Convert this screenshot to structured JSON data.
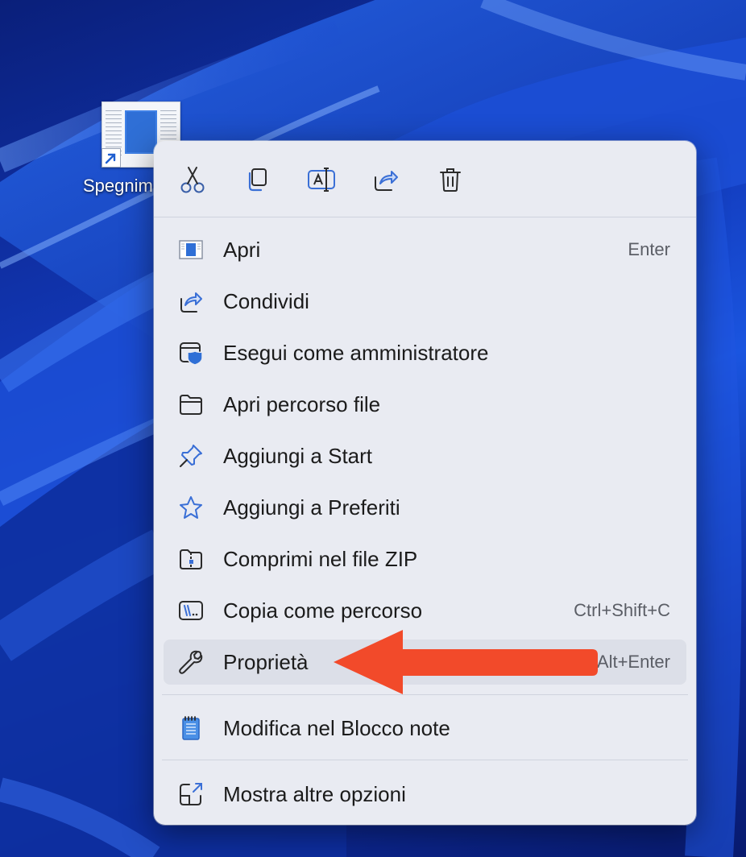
{
  "desktop": {
    "shortcut_label": "Spegnim"
  },
  "toolbar": {
    "cut": "scissors-icon",
    "copy": "copy-icon",
    "rename": "rename-icon",
    "share": "share-icon",
    "delete": "trash-icon"
  },
  "menu": {
    "items": [
      {
        "label": "Apri",
        "shortcut": "Enter"
      },
      {
        "label": "Condividi",
        "shortcut": ""
      },
      {
        "label": "Esegui come amministratore",
        "shortcut": ""
      },
      {
        "label": "Apri percorso file",
        "shortcut": ""
      },
      {
        "label": "Aggiungi a Start",
        "shortcut": ""
      },
      {
        "label": "Aggiungi a Preferiti",
        "shortcut": ""
      },
      {
        "label": "Comprimi nel file ZIP",
        "shortcut": ""
      },
      {
        "label": "Copia come percorso",
        "shortcut": "Ctrl+Shift+C"
      },
      {
        "label": "Proprietà",
        "shortcut": "Alt+Enter"
      },
      {
        "label": "Modifica nel Blocco note",
        "shortcut": ""
      },
      {
        "label": "Mostra altre opzioni",
        "shortcut": ""
      }
    ]
  },
  "colors": {
    "accent": "#2f6fd6",
    "annotation_arrow": "#f24a2a",
    "menu_bg": "#e9ebf2"
  }
}
